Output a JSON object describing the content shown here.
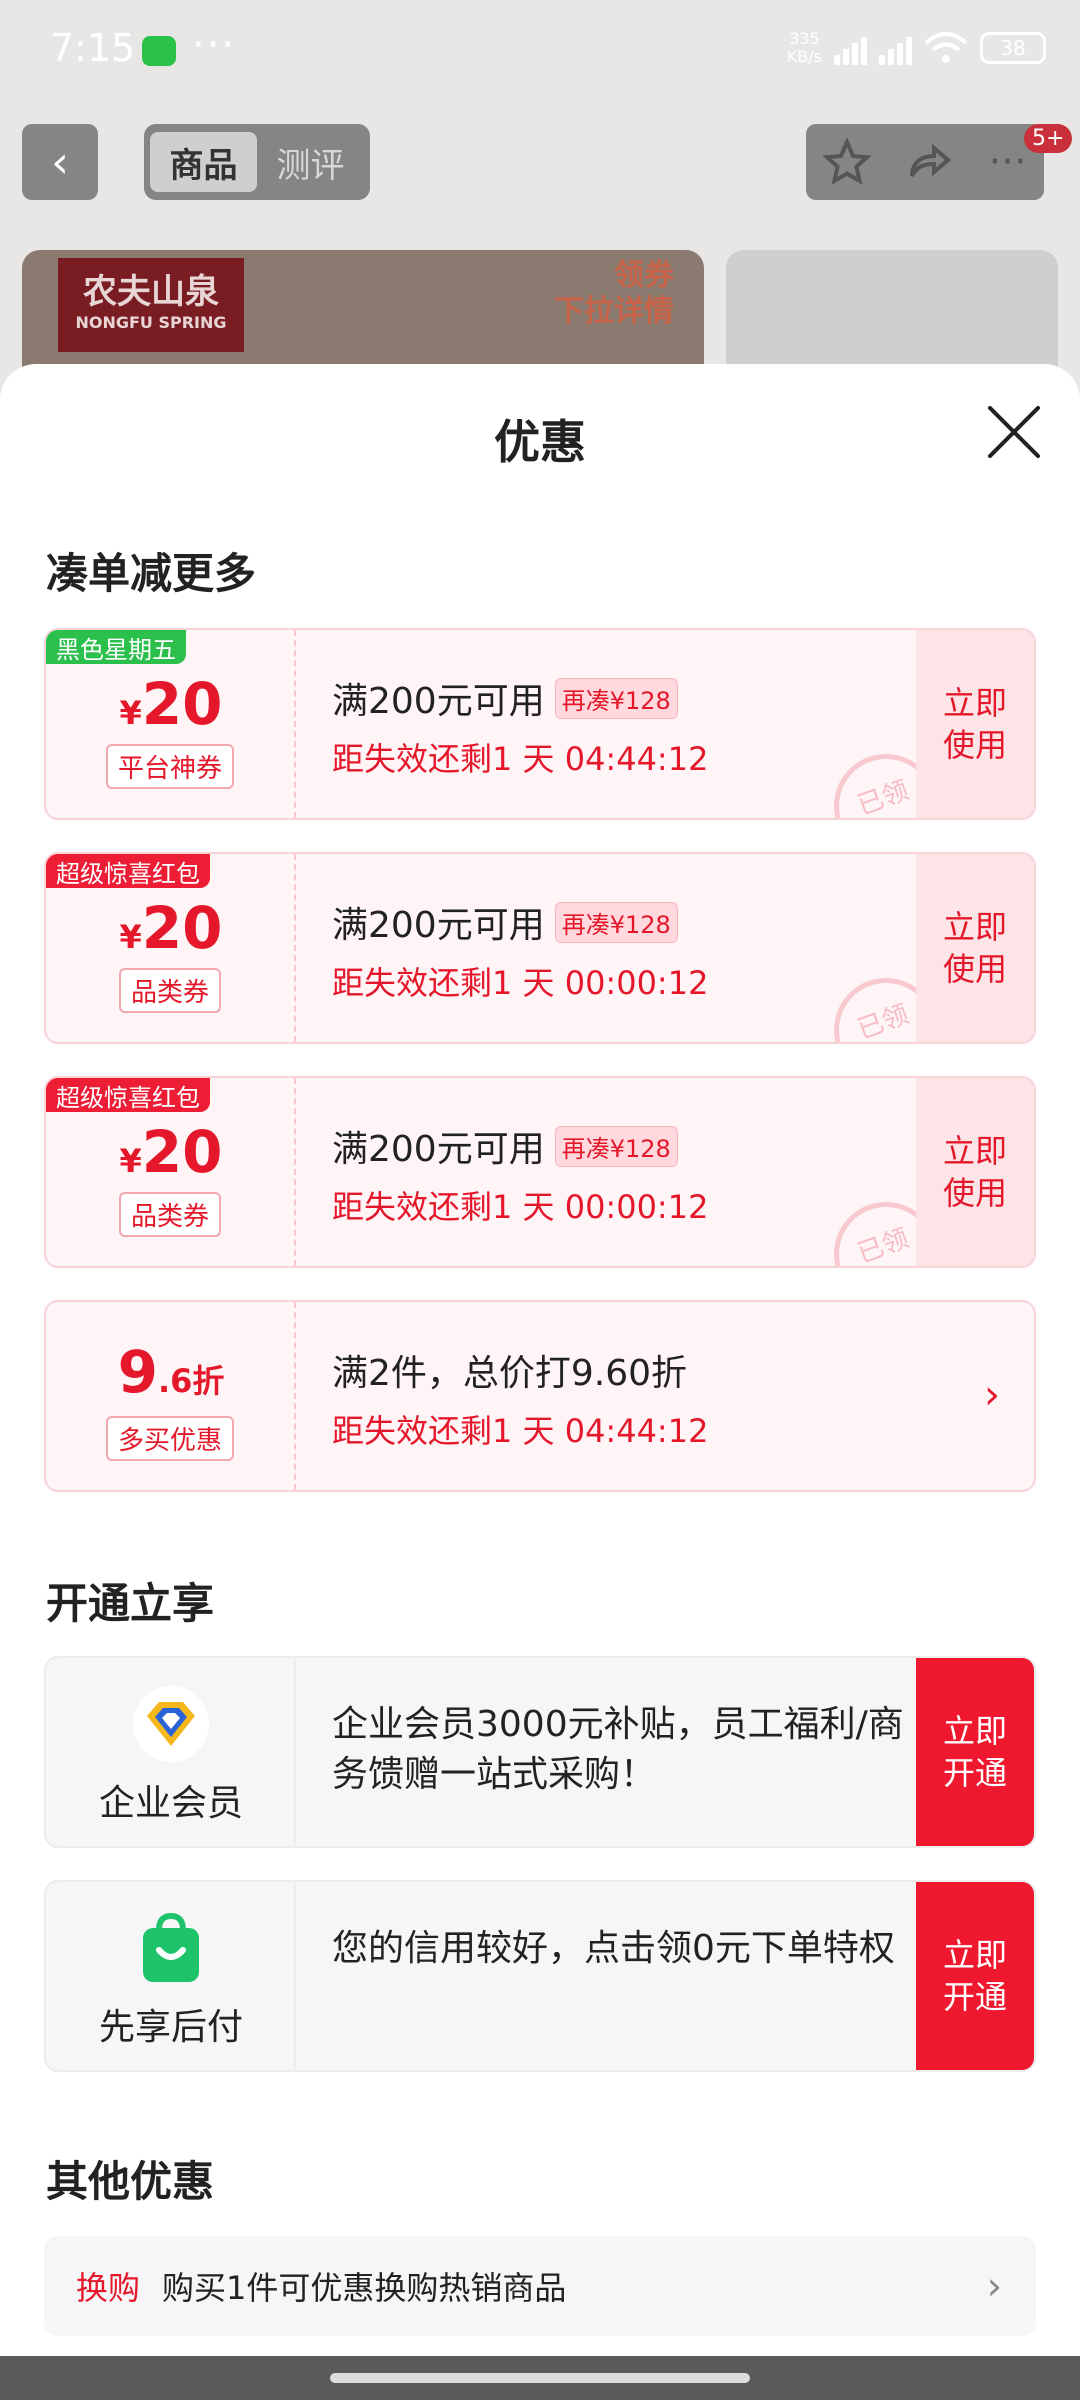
{
  "status": {
    "time": "7:15",
    "net_speed_value": "335",
    "net_speed_unit": "KB/s",
    "battery": "38"
  },
  "nav": {
    "tabs": [
      "商品",
      "测评"
    ],
    "badge": "5+"
  },
  "bg": {
    "brand_cn": "农夫山泉",
    "brand_en": "NONGFU SPRING",
    "promo_line1": "领券",
    "promo_line2": "下拉详情"
  },
  "sheet": {
    "title": "优惠",
    "section1": "凑单减更多",
    "coupons": [
      {
        "tag": "黑色星期五",
        "tag_color": "#2bbf4c",
        "yen": "¥",
        "amount": "20",
        "type": "平台神券",
        "cond": "满200元可用",
        "more": "再凑¥128",
        "timer": "距失效还剩1 天 04:44:12",
        "use": "立即使用",
        "stamp": "已领"
      },
      {
        "tag": "超级惊喜红包",
        "tag_color": "#ee1d36",
        "yen": "¥",
        "amount": "20",
        "type": "品类券",
        "cond": "满200元可用",
        "more": "再凑¥128",
        "timer": "距失效还剩1 天 00:00:12",
        "use": "立即使用",
        "stamp": "已领"
      },
      {
        "tag": "超级惊喜红包",
        "tag_color": "#ee1d36",
        "yen": "¥",
        "amount": "20",
        "type": "品类券",
        "cond": "满200元可用",
        "more": "再凑¥128",
        "timer": "距失效还剩1 天 00:00:12",
        "use": "立即使用",
        "stamp": "已领"
      }
    ],
    "discount": {
      "big": "9",
      "small": ".6折",
      "type": "多买优惠",
      "cond": "满2件，总价打9.60折",
      "timer": "距失效还剩1 天 04:44:12"
    },
    "section2": "开通立享",
    "services": [
      {
        "name": "企业会员",
        "desc": "企业会员3000元补贴，员工福利/商务馈赠一站式采购！",
        "open": "立即开通",
        "icon": "diamond-icon"
      },
      {
        "name": "先享后付",
        "desc": "您的信用较好，点击领0元下单特权",
        "open": "立即开通",
        "icon": "shopping-bag-icon"
      }
    ],
    "section3": "其他优惠",
    "other": {
      "label": "换购",
      "text": "购买1件可优惠换购热销商品"
    }
  }
}
